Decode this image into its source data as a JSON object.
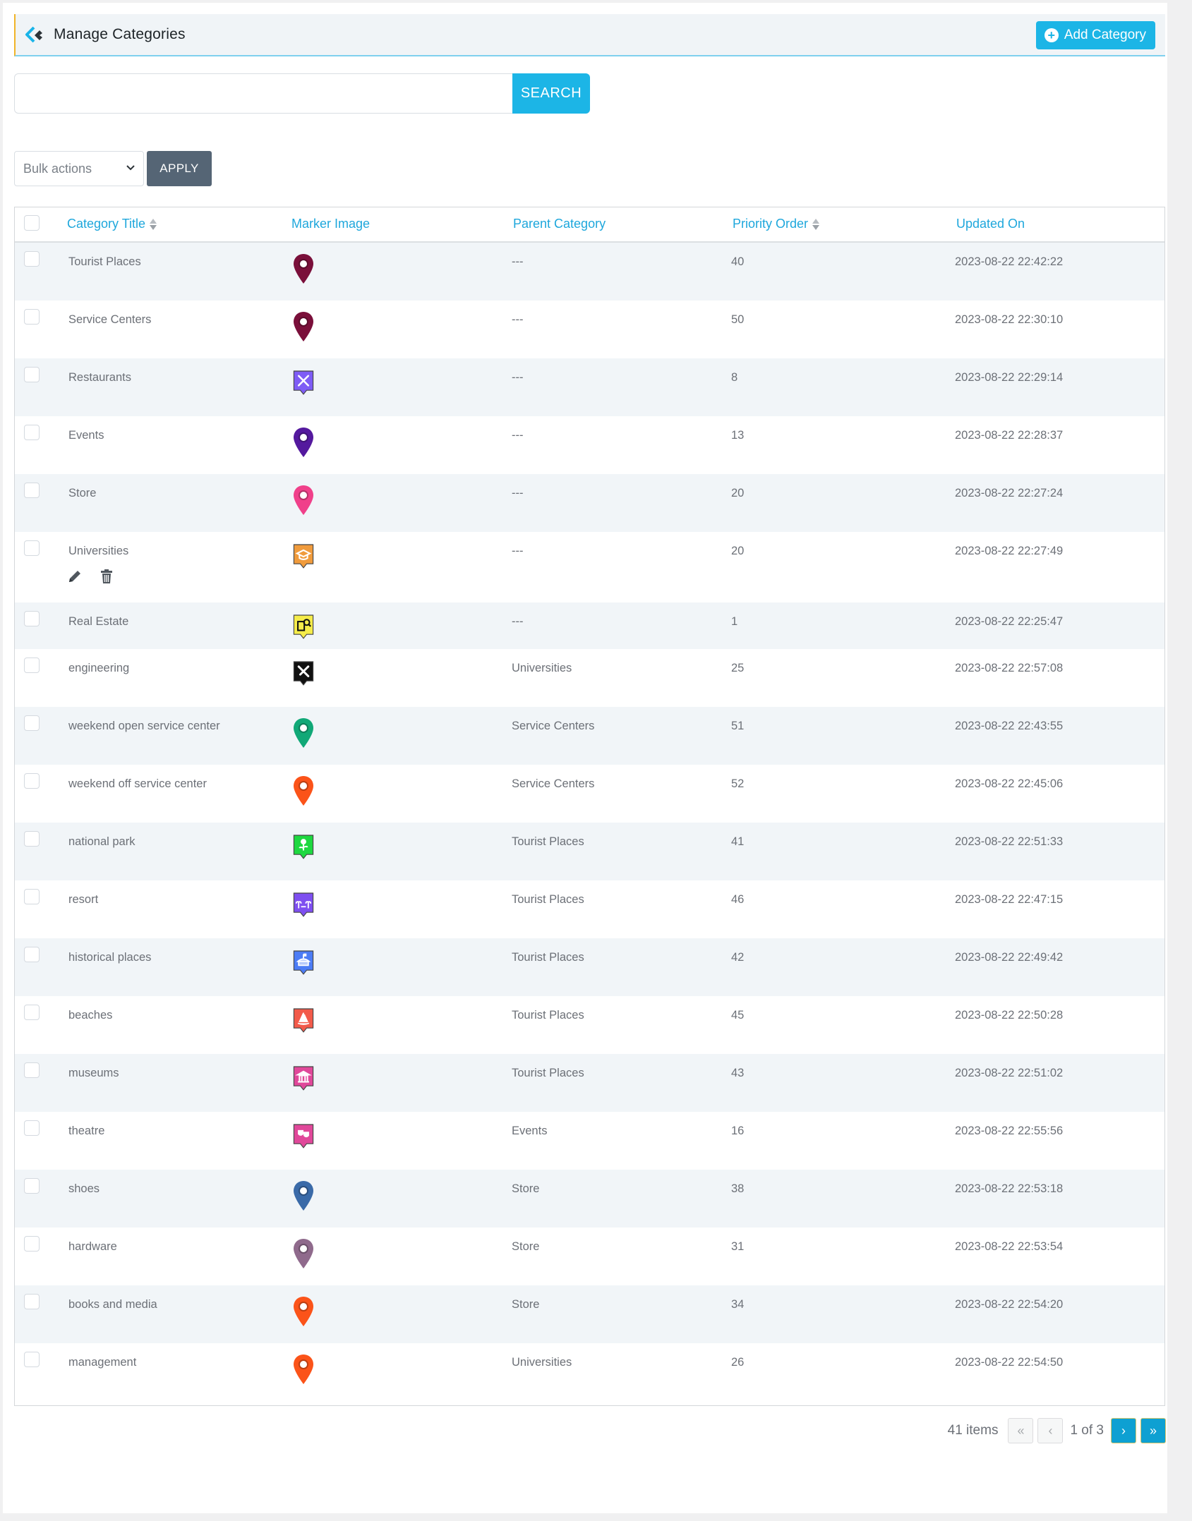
{
  "header": {
    "title": "Manage Categories",
    "add_button": "Add Category",
    "colors": {
      "accent": "#1cb5e6",
      "header_bg": "#f0f4f7",
      "left_border": "#f0b429"
    }
  },
  "search": {
    "value": "",
    "placeholder": "",
    "button": "SEARCH"
  },
  "bulk": {
    "selected": "Bulk actions",
    "apply": "APPLY"
  },
  "table": {
    "columns": [
      {
        "label": "Category Title",
        "sortable": true
      },
      {
        "label": "Marker Image",
        "sortable": false
      },
      {
        "label": "Parent Category",
        "sortable": false
      },
      {
        "label": "Priority Order",
        "sortable": true
      },
      {
        "label": "Updated On",
        "sortable": false
      }
    ],
    "rows": [
      {
        "title": "Tourist Places",
        "marker": "pin",
        "marker_color": "#7a0f3a",
        "parent": "---",
        "priority": "40",
        "updated": "2023-08-22 22:42:22"
      },
      {
        "title": "Service Centers",
        "marker": "pin",
        "marker_color": "#7a0f3a",
        "parent": "---",
        "priority": "50",
        "updated": "2023-08-22 22:30:10"
      },
      {
        "title": "Restaurants",
        "marker": "restaurant-icon",
        "marker_color": "#7e5cf5",
        "parent": "---",
        "priority": "8",
        "updated": "2023-08-22 22:29:14"
      },
      {
        "title": "Events",
        "marker": "pin",
        "marker_color": "#54199e",
        "parent": "---",
        "priority": "13",
        "updated": "2023-08-22 22:28:37"
      },
      {
        "title": "Store",
        "marker": "pin",
        "marker_color": "#f0408a",
        "parent": "---",
        "priority": "20",
        "updated": "2023-08-22 22:27:24"
      },
      {
        "title": "Universities",
        "marker": "graduation-cap-icon",
        "marker_color": "#f09b3c",
        "parent": "---",
        "priority": "20",
        "updated": "2023-08-22 22:27:49",
        "hover_actions": [
          "edit",
          "delete"
        ]
      },
      {
        "title": "Real Estate",
        "marker": "real-estate-icon",
        "marker_color": "#f5ec4a",
        "parent": "---",
        "priority": "1",
        "updated": "2023-08-22 22:25:47"
      },
      {
        "title": "engineering",
        "marker": "tools-icon",
        "marker_color": "#111111",
        "parent": "Universities",
        "priority": "25",
        "updated": "2023-08-22 22:57:08"
      },
      {
        "title": "weekend open service center",
        "marker": "pin",
        "marker_color": "#11a877",
        "parent": "Service Centers",
        "priority": "51",
        "updated": "2023-08-22 22:43:55"
      },
      {
        "title": "weekend off service center",
        "marker": "pin",
        "marker_color": "#fb5319",
        "parent": "Service Centers",
        "priority": "52",
        "updated": "2023-08-22 22:45:06"
      },
      {
        "title": "national park",
        "marker": "flower-icon",
        "marker_color": "#1ed840",
        "parent": "Tourist Places",
        "priority": "41",
        "updated": "2023-08-22 22:51:33"
      },
      {
        "title": "resort",
        "marker": "resort-icon",
        "marker_color": "#7e4ff0",
        "parent": "Tourist Places",
        "priority": "46",
        "updated": "2023-08-22 22:47:15"
      },
      {
        "title": "historical places",
        "marker": "historic-building-icon",
        "marker_color": "#4c7cf5",
        "parent": "Tourist Places",
        "priority": "42",
        "updated": "2023-08-22 22:49:42"
      },
      {
        "title": "beaches",
        "marker": "sailboat-icon",
        "marker_color": "#f25a4a",
        "parent": "Tourist Places",
        "priority": "45",
        "updated": "2023-08-22 22:50:28"
      },
      {
        "title": "museums",
        "marker": "museum-icon",
        "marker_color": "#e0489a",
        "parent": "Tourist Places",
        "priority": "43",
        "updated": "2023-08-22 22:51:02"
      },
      {
        "title": "theatre",
        "marker": "theatre-masks-icon",
        "marker_color": "#e0489a",
        "parent": "Events",
        "priority": "16",
        "updated": "2023-08-22 22:55:56"
      },
      {
        "title": "shoes",
        "marker": "pin",
        "marker_color": "#3a6aa8",
        "parent": "Store",
        "priority": "38",
        "updated": "2023-08-22 22:53:18"
      },
      {
        "title": "hardware",
        "marker": "pin",
        "marker_color": "#8f6a8c",
        "parent": "Store",
        "priority": "31",
        "updated": "2023-08-22 22:53:54"
      },
      {
        "title": "books and media",
        "marker": "pin",
        "marker_color": "#fb5319",
        "parent": "Store",
        "priority": "34",
        "updated": "2023-08-22 22:54:20"
      },
      {
        "title": "management",
        "marker": "pin",
        "marker_color": "#fb5319",
        "parent": "Universities",
        "priority": "26",
        "updated": "2023-08-22 22:54:50"
      }
    ]
  },
  "pagination": {
    "items": "41 items",
    "first": "«",
    "prev": "‹",
    "current": "1 of 3",
    "next": "›",
    "last": "»"
  }
}
